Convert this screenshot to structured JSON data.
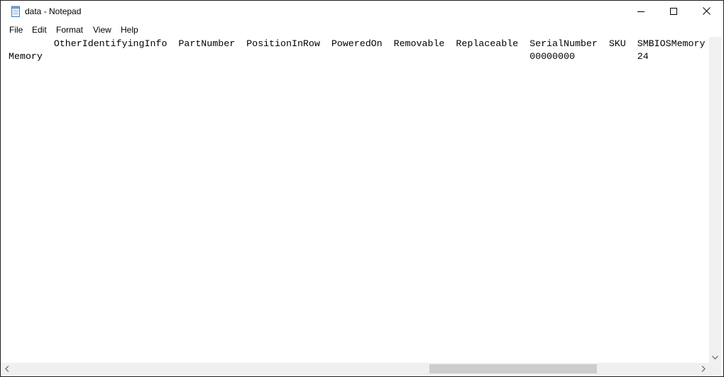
{
  "window": {
    "title": "data - Notepad",
    "icon": "notepad-icon"
  },
  "menu": {
    "file": "File",
    "edit": "Edit",
    "format": "Format",
    "view": "View",
    "help": "Help"
  },
  "document": {
    "lines": [
      "        OtherIdentifyingInfo  PartNumber  PositionInRow  PoweredOn  Removable  Replaceable  SerialNumber  SKU  SMBIOSMemory",
      "Memory                                                                                      00000000           24"
    ]
  },
  "icons": {
    "minimize": "minimize-icon",
    "maximize": "maximize-icon",
    "close": "close-icon",
    "scroll_down": "chevron-down-icon",
    "scroll_left": "chevron-left-icon",
    "scroll_right": "chevron-right-icon"
  }
}
